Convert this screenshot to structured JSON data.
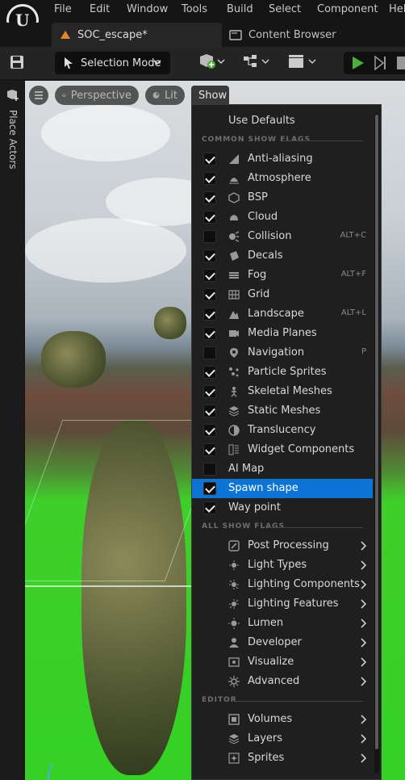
{
  "menubar": {
    "logo_letter": "U",
    "items": [
      "File",
      "Edit",
      "Window",
      "Tools",
      "Build",
      "Select",
      "Component",
      "Hel"
    ]
  },
  "tabs": {
    "level_tab": "SOC_escape*",
    "content_browser_tab": "Content Browser"
  },
  "toolbar": {
    "mode_label": "Selection Mode"
  },
  "sidepanel": {
    "place_actors": "Place Actors"
  },
  "viewport": {
    "perspective_label": "Perspective",
    "lit_label": "Lit",
    "show_label": "Show",
    "axis_label": "Z"
  },
  "show_menu": {
    "use_defaults": "Use Defaults",
    "common_header": "COMMON SHOW FLAGS",
    "all_header": "ALL SHOW FLAGS",
    "editor_header": "EDITOR",
    "common_flags": [
      {
        "label": "Anti-aliasing",
        "checked": true,
        "shortcut": "",
        "icon": "anti-aliasing-icon"
      },
      {
        "label": "Atmosphere",
        "checked": true,
        "shortcut": "",
        "icon": "atmosphere-icon"
      },
      {
        "label": "BSP",
        "checked": true,
        "shortcut": "",
        "icon": "bsp-icon"
      },
      {
        "label": "Cloud",
        "checked": true,
        "shortcut": "",
        "icon": "cloud-icon"
      },
      {
        "label": "Collision",
        "checked": false,
        "shortcut": "ALT+C",
        "icon": "collision-icon"
      },
      {
        "label": "Decals",
        "checked": true,
        "shortcut": "",
        "icon": "decals-icon"
      },
      {
        "label": "Fog",
        "checked": true,
        "shortcut": "ALT+F",
        "icon": "fog-icon"
      },
      {
        "label": "Grid",
        "checked": true,
        "shortcut": "",
        "icon": "grid-icon"
      },
      {
        "label": "Landscape",
        "checked": true,
        "shortcut": "ALT+L",
        "icon": "landscape-icon"
      },
      {
        "label": "Media Planes",
        "checked": true,
        "shortcut": "",
        "icon": "media-planes-icon"
      },
      {
        "label": "Navigation",
        "checked": false,
        "shortcut": "P",
        "icon": "navigation-icon"
      },
      {
        "label": "Particle Sprites",
        "checked": true,
        "shortcut": "",
        "icon": "particle-sprites-icon"
      },
      {
        "label": "Skeletal Meshes",
        "checked": true,
        "shortcut": "",
        "icon": "skeletal-meshes-icon"
      },
      {
        "label": "Static Meshes",
        "checked": true,
        "shortcut": "",
        "icon": "static-meshes-icon"
      },
      {
        "label": "Translucency",
        "checked": true,
        "shortcut": "",
        "icon": "translucency-icon"
      },
      {
        "label": "Widget Components",
        "checked": true,
        "shortcut": "",
        "icon": "widget-components-icon"
      },
      {
        "label": "AI Map",
        "checked": false,
        "shortcut": "",
        "icon": ""
      },
      {
        "label": "Spawn shape",
        "checked": true,
        "shortcut": "",
        "icon": "",
        "selected": true
      },
      {
        "label": "Way point",
        "checked": true,
        "shortcut": "",
        "icon": ""
      }
    ],
    "all_flags": [
      {
        "label": "Post Processing",
        "icon": "post-processing-icon"
      },
      {
        "label": "Light Types",
        "icon": "light-types-icon"
      },
      {
        "label": "Lighting Components",
        "icon": "lighting-components-icon"
      },
      {
        "label": "Lighting Features",
        "icon": "lighting-features-icon"
      },
      {
        "label": "Lumen",
        "icon": "lumen-icon"
      },
      {
        "label": "Developer",
        "icon": "developer-icon"
      },
      {
        "label": "Visualize",
        "icon": "visualize-icon"
      },
      {
        "label": "Advanced",
        "icon": "advanced-icon"
      }
    ],
    "editor_flags": [
      {
        "label": "Volumes",
        "icon": "volumes-icon"
      },
      {
        "label": "Layers",
        "icon": "layers-icon"
      },
      {
        "label": "Sprites",
        "icon": "sprites-icon"
      }
    ]
  },
  "colors": {
    "selection_blue": "#0d74d6",
    "play_green": "#4caf3a",
    "viewport_green": "#35d124"
  }
}
